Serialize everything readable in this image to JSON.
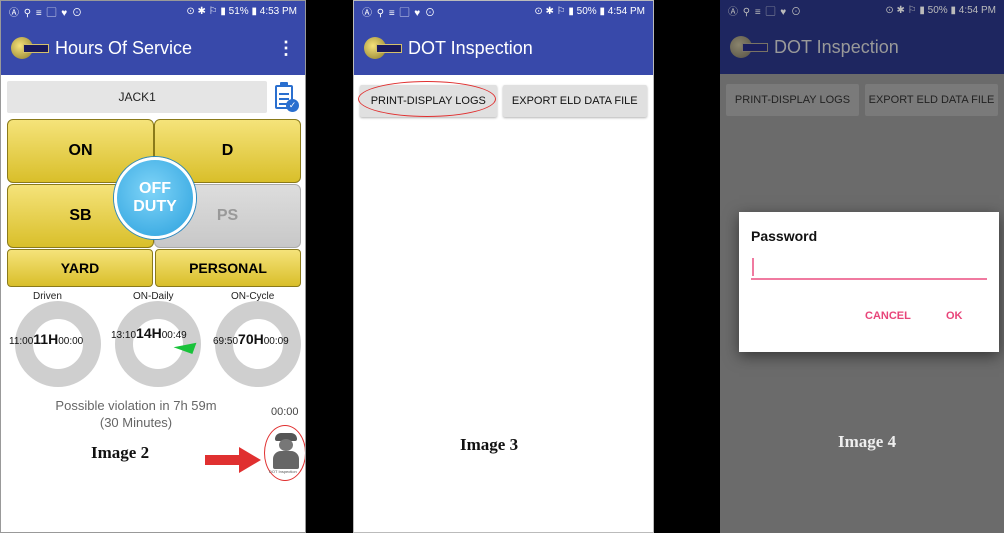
{
  "phone1": {
    "status": {
      "left": "Ⓐ ⚲ ≡ ▢ ♥ ⊙",
      "right": "⊙ ✱ ⚐ ▮ 51% ▮ 4:53 PM"
    },
    "app_title": "Hours Of Service",
    "driver": "JACK1",
    "buttons": {
      "on": "ON",
      "d": "D",
      "sb": "SB",
      "ps": "PS",
      "yard": "YARD",
      "personal": "PERSONAL"
    },
    "current_status": {
      "line1": "OFF",
      "line2": "DUTY"
    },
    "gauges": [
      {
        "label": "Driven",
        "left": "11:00",
        "center": "11H",
        "right": "00:00"
      },
      {
        "label": "ON-Daily",
        "left": "13:10",
        "center": "14H",
        "right": "00:49"
      },
      {
        "label": "ON-Cycle",
        "left": "69:50",
        "center": "70H",
        "right": "00:09"
      }
    ],
    "violation": {
      "line1": "Possible violation in 7h 59m",
      "line2": "(30 Minutes)",
      "time": "00:00"
    },
    "caption": "Image 2",
    "dot_icon_label": "DOT Inspection"
  },
  "phone2": {
    "status": {
      "left": "Ⓐ ⚲ ≡ ▢ ♥ ⊙",
      "right": "⊙ ✱ ⚐ ▮ 50% ▮ 4:54 PM"
    },
    "app_title": "DOT Inspection",
    "print_label": "PRINT-DISPLAY LOGS",
    "export_label": "EXPORT ELD DATA FILE",
    "caption": "Image 3"
  },
  "phone3": {
    "status": {
      "left": "Ⓐ ⚲ ≡ ▢ ♥ ⊙",
      "right": "⊙ ✱ ⚐ ▮ 50% ▮ 4:54 PM"
    },
    "app_title": "DOT Inspection",
    "print_label": "PRINT-DISPLAY LOGS",
    "export_label": "EXPORT ELD DATA FILE",
    "dialog_title": "Password",
    "password_value": "",
    "cancel_label": "CANCEL",
    "ok_label": "OK",
    "caption": "Image 4"
  },
  "colors": {
    "app_bar": "#3849aa",
    "yellow_button": "#e8cf3c",
    "off_duty_blue": "#2aa0dd",
    "accent_pink": "#e8457a",
    "annotation_red": "#e03030"
  }
}
